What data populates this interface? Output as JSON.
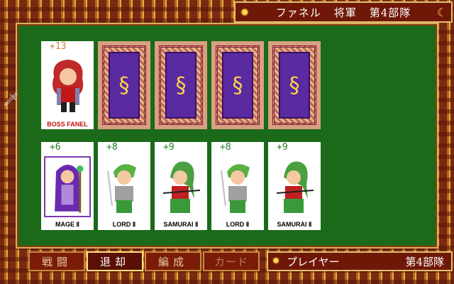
{
  "header": {
    "name": "ファネル",
    "rank": "将軍",
    "unit": "第4部隊",
    "emblem_icon": "dragon-emblem-icon"
  },
  "enemy_row": {
    "leader": {
      "power": "+13",
      "name": "BOSS FANEL"
    },
    "hidden_cards": 4,
    "card_back_icon": "dragon-crest-icon"
  },
  "player_row": [
    {
      "power": "+6",
      "name": "MAGE Ⅱ"
    },
    {
      "power": "+8",
      "name": "LORD Ⅱ"
    },
    {
      "power": "+9",
      "name": "SAMURAI Ⅱ"
    },
    {
      "power": "+8",
      "name": "LORD Ⅱ"
    },
    {
      "power": "+9",
      "name": "SAMURAI Ⅱ"
    }
  ],
  "menu": {
    "battle": "戦闘",
    "retreat": "退却",
    "formation": "編成",
    "cards": "カード"
  },
  "footer": {
    "side": "プレイヤー",
    "unit": "第4部隊"
  },
  "colors": {
    "felt": "#1a6a1a",
    "frame": "#701808",
    "trim": "#e0c070",
    "card_back": "#5a2aa0"
  }
}
